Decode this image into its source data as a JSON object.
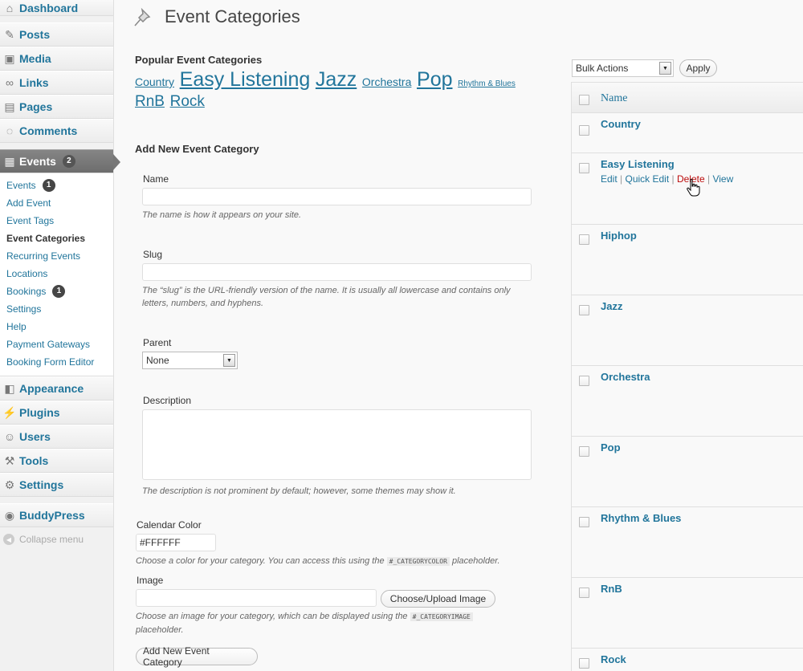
{
  "sidebar": {
    "dashboard": "Dashboard",
    "posts": "Posts",
    "media": "Media",
    "links": "Links",
    "pages": "Pages",
    "comments": "Comments",
    "events": "Events",
    "events_badge": "2",
    "submenu": [
      {
        "label": "Events",
        "badge": "1"
      },
      {
        "label": "Add Event"
      },
      {
        "label": "Event Tags"
      },
      {
        "label": "Event Categories"
      },
      {
        "label": "Recurring Events"
      },
      {
        "label": "Locations"
      },
      {
        "label": "Bookings",
        "badge": "1"
      },
      {
        "label": "Settings"
      },
      {
        "label": "Help"
      },
      {
        "label": "Payment Gateways"
      },
      {
        "label": "Booking Form Editor"
      }
    ],
    "appearance": "Appearance",
    "plugins": "Plugins",
    "users": "Users",
    "tools": "Tools",
    "settings": "Settings",
    "buddypress": "BuddyPress",
    "collapse": "Collapse menu"
  },
  "page": {
    "title": "Event Categories"
  },
  "popular": {
    "heading": "Popular Event Categories",
    "tags": [
      {
        "label": "Country"
      },
      {
        "label": "Easy Listening"
      },
      {
        "label": "Jazz"
      },
      {
        "label": "Orchestra"
      },
      {
        "label": "Pop"
      },
      {
        "label": "Rhythm & Blues"
      },
      {
        "label": "RnB"
      },
      {
        "label": "Rock"
      }
    ]
  },
  "form": {
    "heading": "Add New Event Category",
    "name_label": "Name",
    "name_hint": "The name is how it appears on your site.",
    "slug_label": "Slug",
    "slug_hint_1": "The “slug” is the URL-friendly version of the name. It is usually all lowercase and contains only",
    "slug_hint_2": "letters, numbers, and hyphens.",
    "parent_label": "Parent",
    "parent_value": "None",
    "description_label": "Description",
    "description_hint": "The description is not prominent by default; however, some themes may show it.",
    "color_label": "Calendar Color",
    "color_value": "#FFFFFF",
    "color_hint_a": "Choose a color for your category. You can access this using the",
    "color_code": "#_CATEGORYCOLOR",
    "color_hint_b": "placeholder.",
    "image_label": "Image",
    "image_button": "Choose/Upload Image",
    "image_hint_a": "Choose an image for your category, which can be displayed using the",
    "image_code": "#_CATEGORYIMAGE",
    "image_hint_b": "placeholder.",
    "submit": "Add New Event Category"
  },
  "table": {
    "bulk_actions": "Bulk Actions",
    "apply": "Apply",
    "column_name": "Name",
    "rows": [
      {
        "name": "Country"
      },
      {
        "name": "Easy Listening",
        "edit": "Edit",
        "quick_edit": "Quick Edit",
        "delete": "Delete",
        "view": "View"
      },
      {
        "name": "Hiphop"
      },
      {
        "name": "Jazz"
      },
      {
        "name": "Orchestra"
      },
      {
        "name": "Pop"
      },
      {
        "name": "Rhythm & Blues"
      },
      {
        "name": "RnB"
      },
      {
        "name": "Rock"
      }
    ]
  },
  "colors": {
    "link": "#21759b",
    "delete": "#bc0b0b",
    "active_menu": "#777777"
  }
}
